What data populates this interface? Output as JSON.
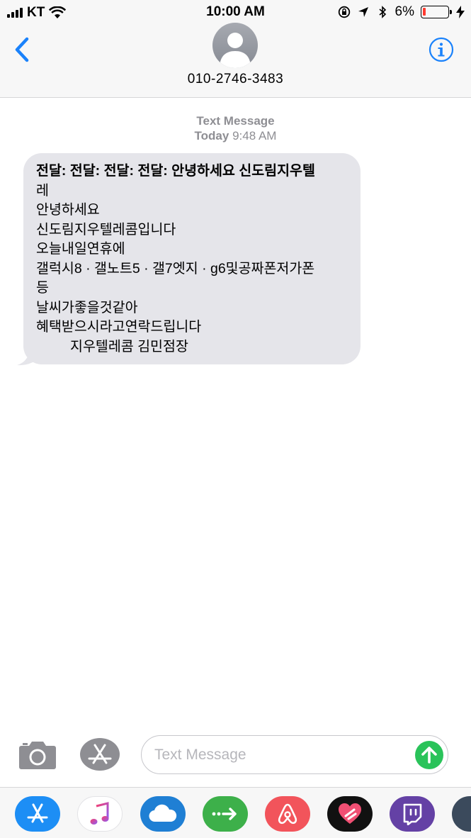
{
  "status_bar": {
    "carrier": "KT",
    "time": "10:00 AM",
    "battery_percent": "6%",
    "battery_level": 0.06
  },
  "header": {
    "contact_number": "010-2746-3483",
    "back_icon": "chevron-left-icon",
    "info_icon": "info-icon",
    "accent_color": "#1a82fb"
  },
  "conversation": {
    "service_label": "Text Message",
    "day_label": "Today",
    "time_label": "9:48 AM",
    "message": {
      "first_line": "전달: 전달: 전달: 전달: 안녕하세요 신도림지우텔",
      "lines": [
        "레",
        "안녕하세요",
        "신도림지우텔레콤입니다",
        "오늘내일연휴에",
        "갤럭시8 · 갤노트5 · 갤7엣지 · g6및공짜폰저가폰",
        "등",
        "날씨가좋을것같아",
        "혜택받으시라고연락드립니다"
      ],
      "signature": "지우텔레콤 김민점장"
    }
  },
  "compose": {
    "placeholder": "Text Message",
    "value": "",
    "send_color": "#2ac35a"
  },
  "app_drawer": {
    "apps": [
      {
        "icon": "app-store-icon",
        "color": "#1d8ef5"
      },
      {
        "icon": "music-icon",
        "color": "#ffffff"
      },
      {
        "icon": "cloud-icon",
        "color": "#1f7fd4"
      },
      {
        "icon": "arrow-icon",
        "color": "#3db04a"
      },
      {
        "icon": "airbnb-icon",
        "color": "#f2545b"
      },
      {
        "icon": "heart-icon",
        "color": "#111111"
      },
      {
        "icon": "twitch-icon",
        "color": "#6441a5"
      },
      {
        "icon": "more-app-icon",
        "color": "#3b4a5c"
      }
    ]
  }
}
